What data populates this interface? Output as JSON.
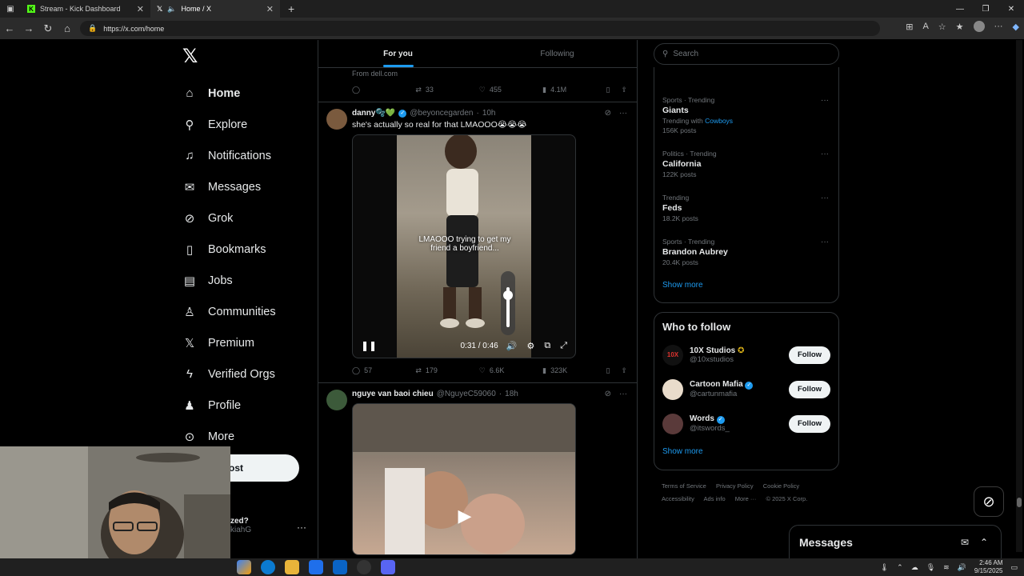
{
  "browser": {
    "tabs": [
      {
        "label": "Stream - Kick Dashboard",
        "active": false
      },
      {
        "label": "Home / X",
        "active": true
      }
    ],
    "url": "https://x.com/home"
  },
  "nav": {
    "items": [
      {
        "label": "Home",
        "icon": "home-icon",
        "active": true
      },
      {
        "label": "Explore",
        "icon": "search-icon"
      },
      {
        "label": "Notifications",
        "icon": "bell-icon"
      },
      {
        "label": "Messages",
        "icon": "mail-icon"
      },
      {
        "label": "Grok",
        "icon": "grok-icon"
      },
      {
        "label": "Bookmarks",
        "icon": "bookmark-icon"
      },
      {
        "label": "Jobs",
        "icon": "briefcase-icon"
      },
      {
        "label": "Communities",
        "icon": "people-icon"
      },
      {
        "label": "Premium",
        "icon": "x-icon"
      },
      {
        "label": "Verified Orgs",
        "icon": "lightning-icon"
      },
      {
        "label": "Profile",
        "icon": "person-icon"
      },
      {
        "label": "More",
        "icon": "more-circle-icon"
      }
    ],
    "post_label": "Post",
    "account_name": "zed?",
    "account_handle": "kiahG"
  },
  "feed": {
    "tabs": [
      {
        "label": "For you",
        "active": true
      },
      {
        "label": "Following",
        "active": false
      }
    ],
    "prev_post": {
      "note": "From dell.com",
      "retweets": "33",
      "likes": "455",
      "views": "4.1M"
    },
    "tweets": [
      {
        "name": "danny🫧💚",
        "handle": "@beyoncegarden",
        "time": "10h",
        "text": "she's actually so real for that LMAOOO😭😭😭",
        "caption": "LMAOOO trying to get my friend a boyfriend...",
        "video_time": "0:31 / 0:46",
        "replies": "57",
        "retweets": "179",
        "likes": "6.6K",
        "views": "323K"
      },
      {
        "name": "nguye van baoi chieu",
        "handle": "@NguyeC59060",
        "time": "18h"
      }
    ]
  },
  "search": {
    "placeholder": "Search"
  },
  "trends": [
    {
      "category": "Sports · Trending",
      "title": "Giants",
      "sub_prefix": "Trending with",
      "sub_link": "Cowboys",
      "posts": "156K posts"
    },
    {
      "category": "Politics · Trending",
      "title": "California",
      "posts": "122K posts"
    },
    {
      "category": "Trending",
      "title": "Feds",
      "posts": "18.2K posts"
    },
    {
      "category": "Sports · Trending",
      "title": "Brandon Aubrey",
      "posts": "20.4K posts"
    }
  ],
  "trends_show_more": "Show more",
  "who_to_follow": {
    "title": "Who to follow",
    "accounts": [
      {
        "name": "10X Studios",
        "handle": "@10xstudios",
        "avatar_text": "10X"
      },
      {
        "name": "Cartoon Mafia",
        "handle": "@cartunmafia",
        "avatar_text": ""
      },
      {
        "name": "Words",
        "handle": "@itswords_",
        "avatar_text": ""
      }
    ],
    "follow_label": "Follow",
    "show_more": "Show more"
  },
  "footer": {
    "links": [
      "Terms of Service",
      "Privacy Policy",
      "Cookie Policy",
      "Accessibility",
      "Ads info",
      "More ···",
      "© 2025 X Corp."
    ]
  },
  "messages_drawer": {
    "title": "Messages"
  },
  "taskbar": {
    "time": "2:46 AM",
    "date": "9/15/2025"
  },
  "colors": {
    "accent": "#1d9bf0",
    "background": "#000000",
    "muted": "#71767b"
  }
}
